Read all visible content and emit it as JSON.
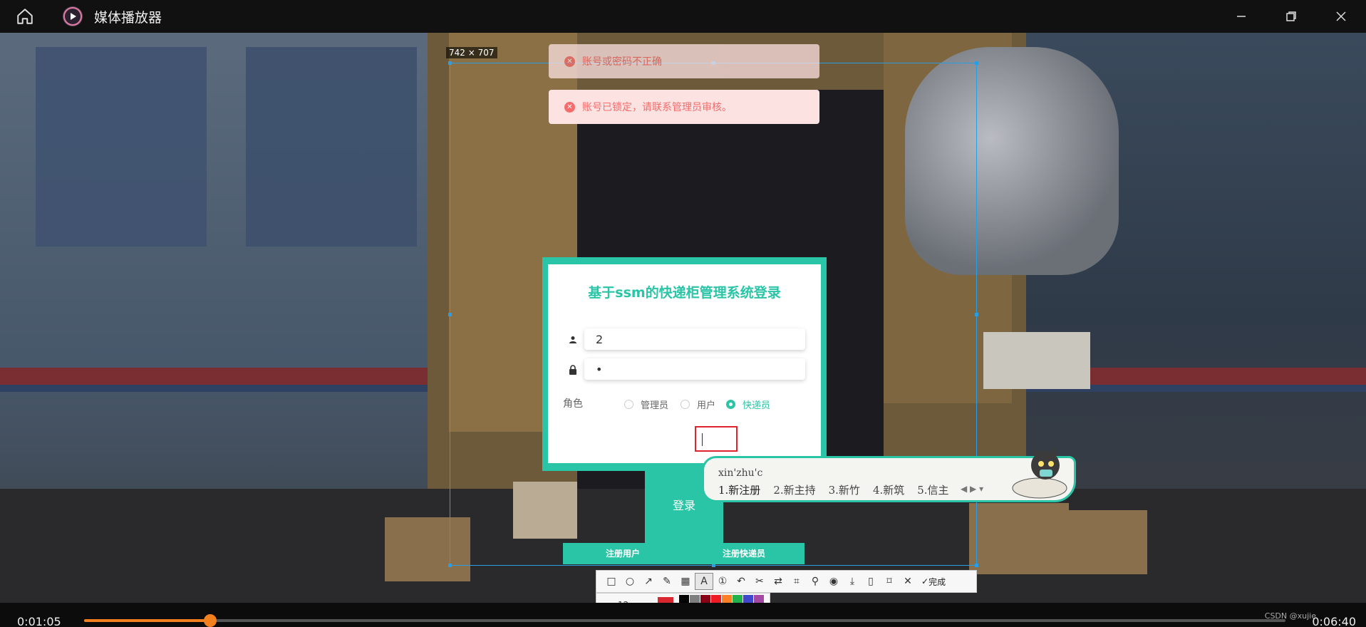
{
  "window": {
    "title": "媒体播放器"
  },
  "selection": {
    "size_label": "742 × 707"
  },
  "toasts": [
    {
      "text": "账号或密码不正确"
    },
    {
      "text": "账号已锁定，请联系管理员审核。"
    }
  ],
  "login": {
    "title": "基于ssm的快递柜管理系统登录",
    "username_value": "2",
    "password_value": "•",
    "role_label": "角色",
    "roles": [
      {
        "label": "管理员",
        "selected": false
      },
      {
        "label": "用户",
        "selected": false
      },
      {
        "label": "快递员",
        "selected": true
      }
    ],
    "login_button": "登录",
    "register_user": "注册用户",
    "register_courier": "注册快递员"
  },
  "ime": {
    "composition": "xin'zhu'c",
    "candidates": [
      "1.新注册",
      "2.新主持",
      "3.新竹",
      "4.新筑",
      "5.信主"
    ]
  },
  "snap_toolbar": {
    "done_label": "完成",
    "font_size": "12",
    "main_color": "#d9262f",
    "swatches": [
      "#000000",
      "#7f7f7f",
      "#880015",
      "#ed1c24",
      "#ff7f27",
      "#22b14c",
      "#3f48cc",
      "#a349a4",
      "#ffffff",
      "#c3c3c3",
      "#b97a57",
      "#ffaec9",
      "#ffc90e",
      "#b5e61d",
      "#00a2e8",
      "#7092be"
    ]
  },
  "player": {
    "current_time": "0:01:05",
    "total_time": "0:06:40",
    "progress": 0.105,
    "accent_color": "#f2801e",
    "watermark": "CSDN @xujie"
  }
}
